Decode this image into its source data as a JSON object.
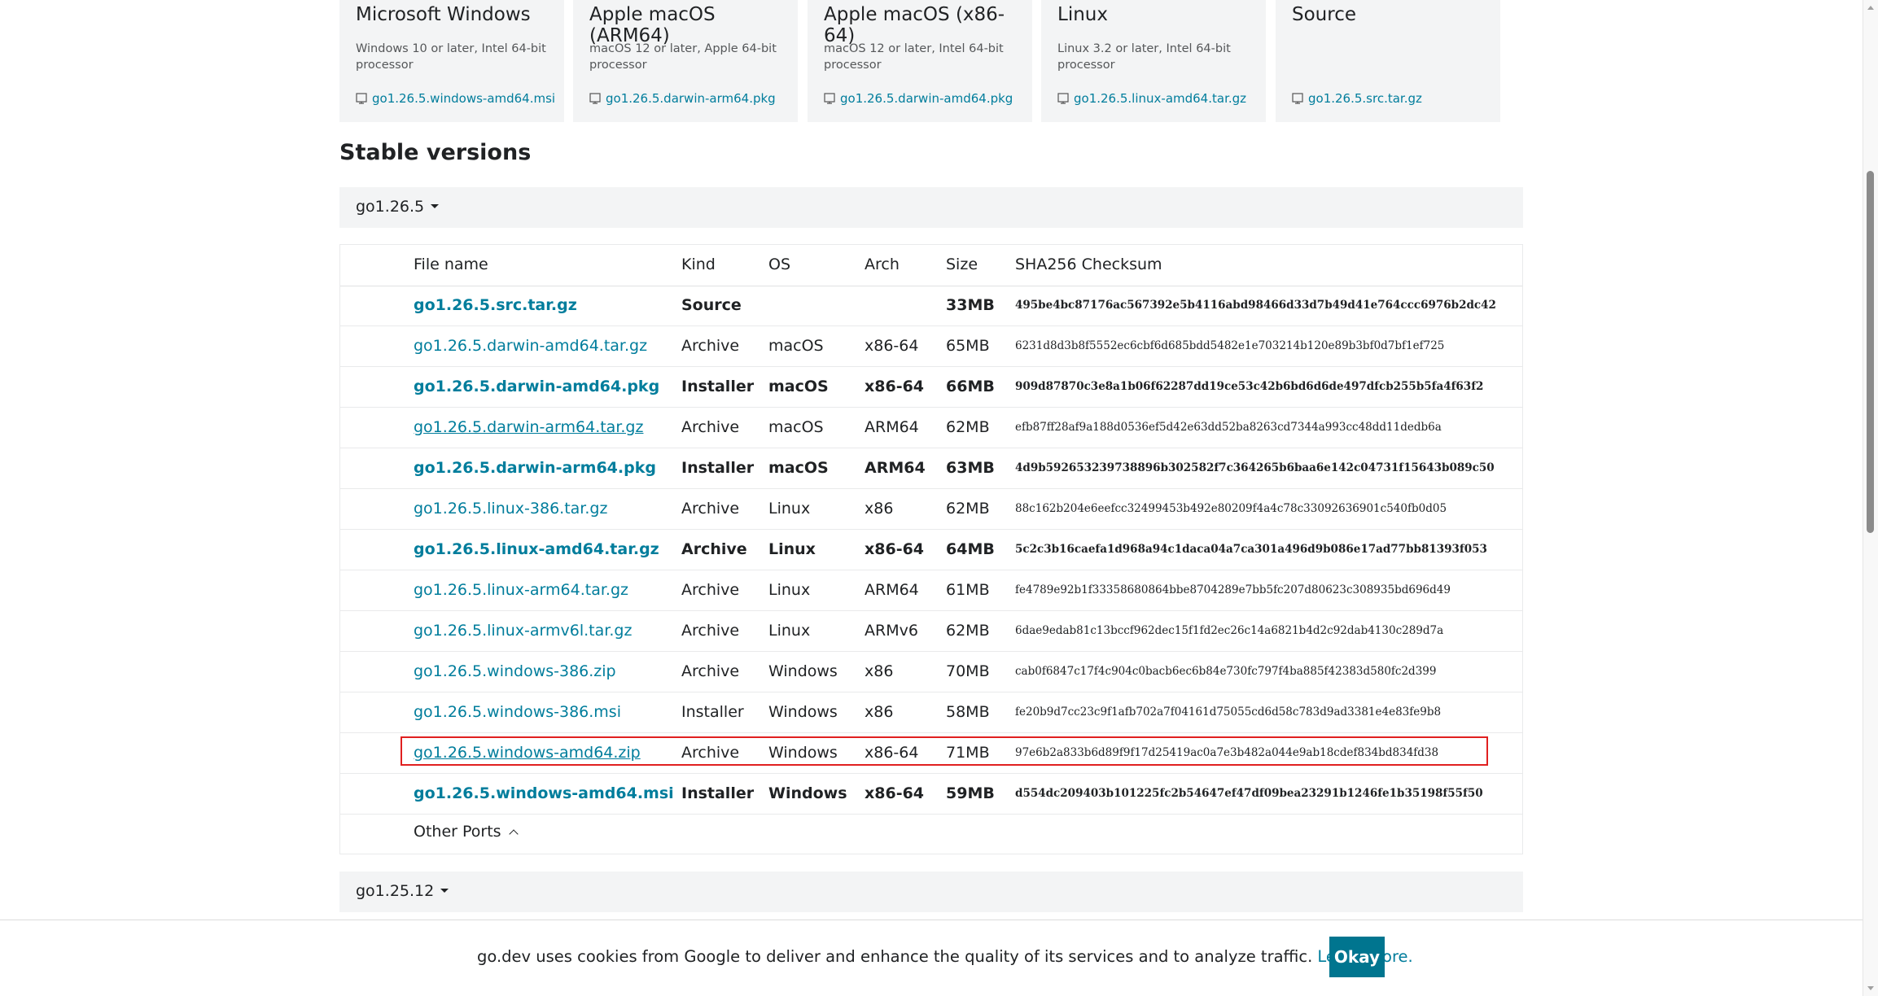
{
  "featured": [
    {
      "os": "Microsoft Windows",
      "desc": "Windows 10 or later, Intel 64-bit processor",
      "file": "go1.26.5.windows-amd64.msi"
    },
    {
      "os": "Apple macOS (ARM64)",
      "desc": "macOS 12 or later, Apple 64-bit processor",
      "file": "go1.26.5.darwin-arm64.pkg"
    },
    {
      "os": "Apple macOS (x86-64)",
      "desc": "macOS 12 or later, Intel 64-bit processor",
      "file": "go1.26.5.darwin-amd64.pkg"
    },
    {
      "os": "Linux",
      "desc": "Linux 3.2 or later, Intel 64-bit processor",
      "file": "go1.26.5.linux-amd64.tar.gz"
    },
    {
      "os": "Source",
      "desc": "",
      "file": "go1.26.5.src.tar.gz"
    }
  ],
  "stable_heading": "Stable versions",
  "versions": [
    {
      "label": "go1.26.5"
    },
    {
      "label": "go1.25.12"
    }
  ],
  "table": {
    "headers": {
      "file_name": "File name",
      "kind": "Kind",
      "os": "OS",
      "arch": "Arch",
      "size": "Size",
      "checksum": "SHA256 Checksum"
    },
    "rows": [
      {
        "file": "go1.26.5.src.tar.gz",
        "kind": "Source",
        "os": "",
        "arch": "",
        "size": "33MB",
        "checksum": "495be4bc87176ac567392e5b4116abd98466d33d7b49d41e764ccc6976b2dc42",
        "featured": true
      },
      {
        "file": "go1.26.5.darwin-amd64.tar.gz",
        "kind": "Archive",
        "os": "macOS",
        "arch": "x86-64",
        "size": "65MB",
        "checksum": "6231d8d3b8f5552ec6cbf6d685bdd5482e1e703214b120e89b3bf0d7bf1ef725",
        "featured": false
      },
      {
        "file": "go1.26.5.darwin-amd64.pkg",
        "kind": "Installer",
        "os": "macOS",
        "arch": "x86-64",
        "size": "66MB",
        "checksum": "909d87870c3e8a1b06f62287dd19ce53c42b6bd6d6de497dfcb255b5fa4f63f2",
        "featured": true
      },
      {
        "file": "go1.26.5.darwin-arm64.tar.gz",
        "kind": "Archive",
        "os": "macOS",
        "arch": "ARM64",
        "size": "62MB",
        "checksum": "efb87ff28af9a188d0536ef5d42e63dd52ba8263cd7344a993cc48dd11dedb6a",
        "featured": false,
        "hovered": true
      },
      {
        "file": "go1.26.5.darwin-arm64.pkg",
        "kind": "Installer",
        "os": "macOS",
        "arch": "ARM64",
        "size": "63MB",
        "checksum": "4d9b592653239738896b302582f7c364265b6baa6e142c04731f15643b089c50",
        "featured": true
      },
      {
        "file": "go1.26.5.linux-386.tar.gz",
        "kind": "Archive",
        "os": "Linux",
        "arch": "x86",
        "size": "62MB",
        "checksum": "88c162b204e6eefcc32499453b492e80209f4a4c78c33092636901c540fb0d05",
        "featured": false
      },
      {
        "file": "go1.26.5.linux-amd64.tar.gz",
        "kind": "Archive",
        "os": "Linux",
        "arch": "x86-64",
        "size": "64MB",
        "checksum": "5c2c3b16caefa1d968a94c1daca04a7ca301a496d9b086e17ad77bb81393f053",
        "featured": true
      },
      {
        "file": "go1.26.5.linux-arm64.tar.gz",
        "kind": "Archive",
        "os": "Linux",
        "arch": "ARM64",
        "size": "61MB",
        "checksum": "fe4789e92b1f33358680864bbe8704289e7bb5fc207d80623c308935bd696d49",
        "featured": false
      },
      {
        "file": "go1.26.5.linux-armv6l.tar.gz",
        "kind": "Archive",
        "os": "Linux",
        "arch": "ARMv6",
        "size": "62MB",
        "checksum": "6dae9edab81c13bccf962dec15f1fd2ec26c14a6821b4d2c92dab4130c289d7a",
        "featured": false
      },
      {
        "file": "go1.26.5.windows-386.zip",
        "kind": "Archive",
        "os": "Windows",
        "arch": "x86",
        "size": "70MB",
        "checksum": "cab0f6847c17f4c904c0bacb6ec6b84e730fc797f4ba885f42383d580fc2d399",
        "featured": false
      },
      {
        "file": "go1.26.5.windows-386.msi",
        "kind": "Installer",
        "os": "Windows",
        "arch": "x86",
        "size": "58MB",
        "checksum": "fe20b9d7cc23c9f1afb702a7f04161d75055cd6d58c783d9ad3381e4e83fe9b8",
        "featured": false
      },
      {
        "file": "go1.26.5.windows-amd64.zip",
        "kind": "Archive",
        "os": "Windows",
        "arch": "x86-64",
        "size": "71MB",
        "checksum": "97e6b2a833b6d89f9f17d25419ac0a7e3b482a044e9ab18cdef834bd834fd38",
        "featured": false,
        "hovered": true,
        "highlighted": true
      },
      {
        "file": "go1.26.5.windows-amd64.msi",
        "kind": "Installer",
        "os": "Windows",
        "arch": "x86-64",
        "size": "59MB",
        "checksum": "d554dc209403b101225fc2b54647ef47df09bea23291b1246fe1b35198f55f50",
        "featured": true
      }
    ],
    "other_ports": "Other Ports"
  },
  "cookie": {
    "text": "go.dev uses cookies from Google to deliver and enhance the quality of its services and to analyze traffic.",
    "link": "Learn more.",
    "button": "Okay"
  },
  "colors": {
    "link": "#007d9c",
    "button": "#00758f",
    "highlight_border": "#e02020",
    "card_bg": "#f3f4f5"
  },
  "icons": {
    "file": "file-icon",
    "caret": "caret-down-icon",
    "chevron": "chevron-up-icon"
  }
}
